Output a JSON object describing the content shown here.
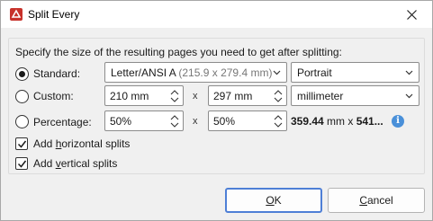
{
  "window": {
    "title": "Split Every",
    "app_icon": "pdf-app-icon",
    "close_icon": "close-icon"
  },
  "heading": "Specify the size of the resulting pages you need to get after splitting:",
  "standard": {
    "label": "Standard:",
    "selected": true,
    "page_size": "Letter/ANSI A",
    "page_size_dims": "(215.9 x 279.4 mm)",
    "orientation": "Portrait"
  },
  "custom": {
    "label": "Custom:",
    "selected": false,
    "width": "210 mm",
    "height": "297 mm",
    "unit": "millimeter"
  },
  "percentage": {
    "label": "Percentage:",
    "selected": false,
    "width": "50%",
    "height": "50%",
    "result_width": "359.44",
    "result_unit": " mm x ",
    "result_height": "541..."
  },
  "separator": "x",
  "splits": {
    "horizontal": {
      "label_pre": "Add ",
      "label_key": "h",
      "label_post": "orizontal splits",
      "checked": true
    },
    "vertical": {
      "label_pre": "Add ",
      "label_key": "v",
      "label_post": "ertical splits",
      "checked": true
    }
  },
  "buttons": {
    "ok_key": "O",
    "ok_rest": "K",
    "cancel_key": "C",
    "cancel_rest": "ancel"
  },
  "colors": {
    "accent": "#4e7fd6",
    "info": "#4a90d9",
    "app_icon": "#c7312a"
  }
}
